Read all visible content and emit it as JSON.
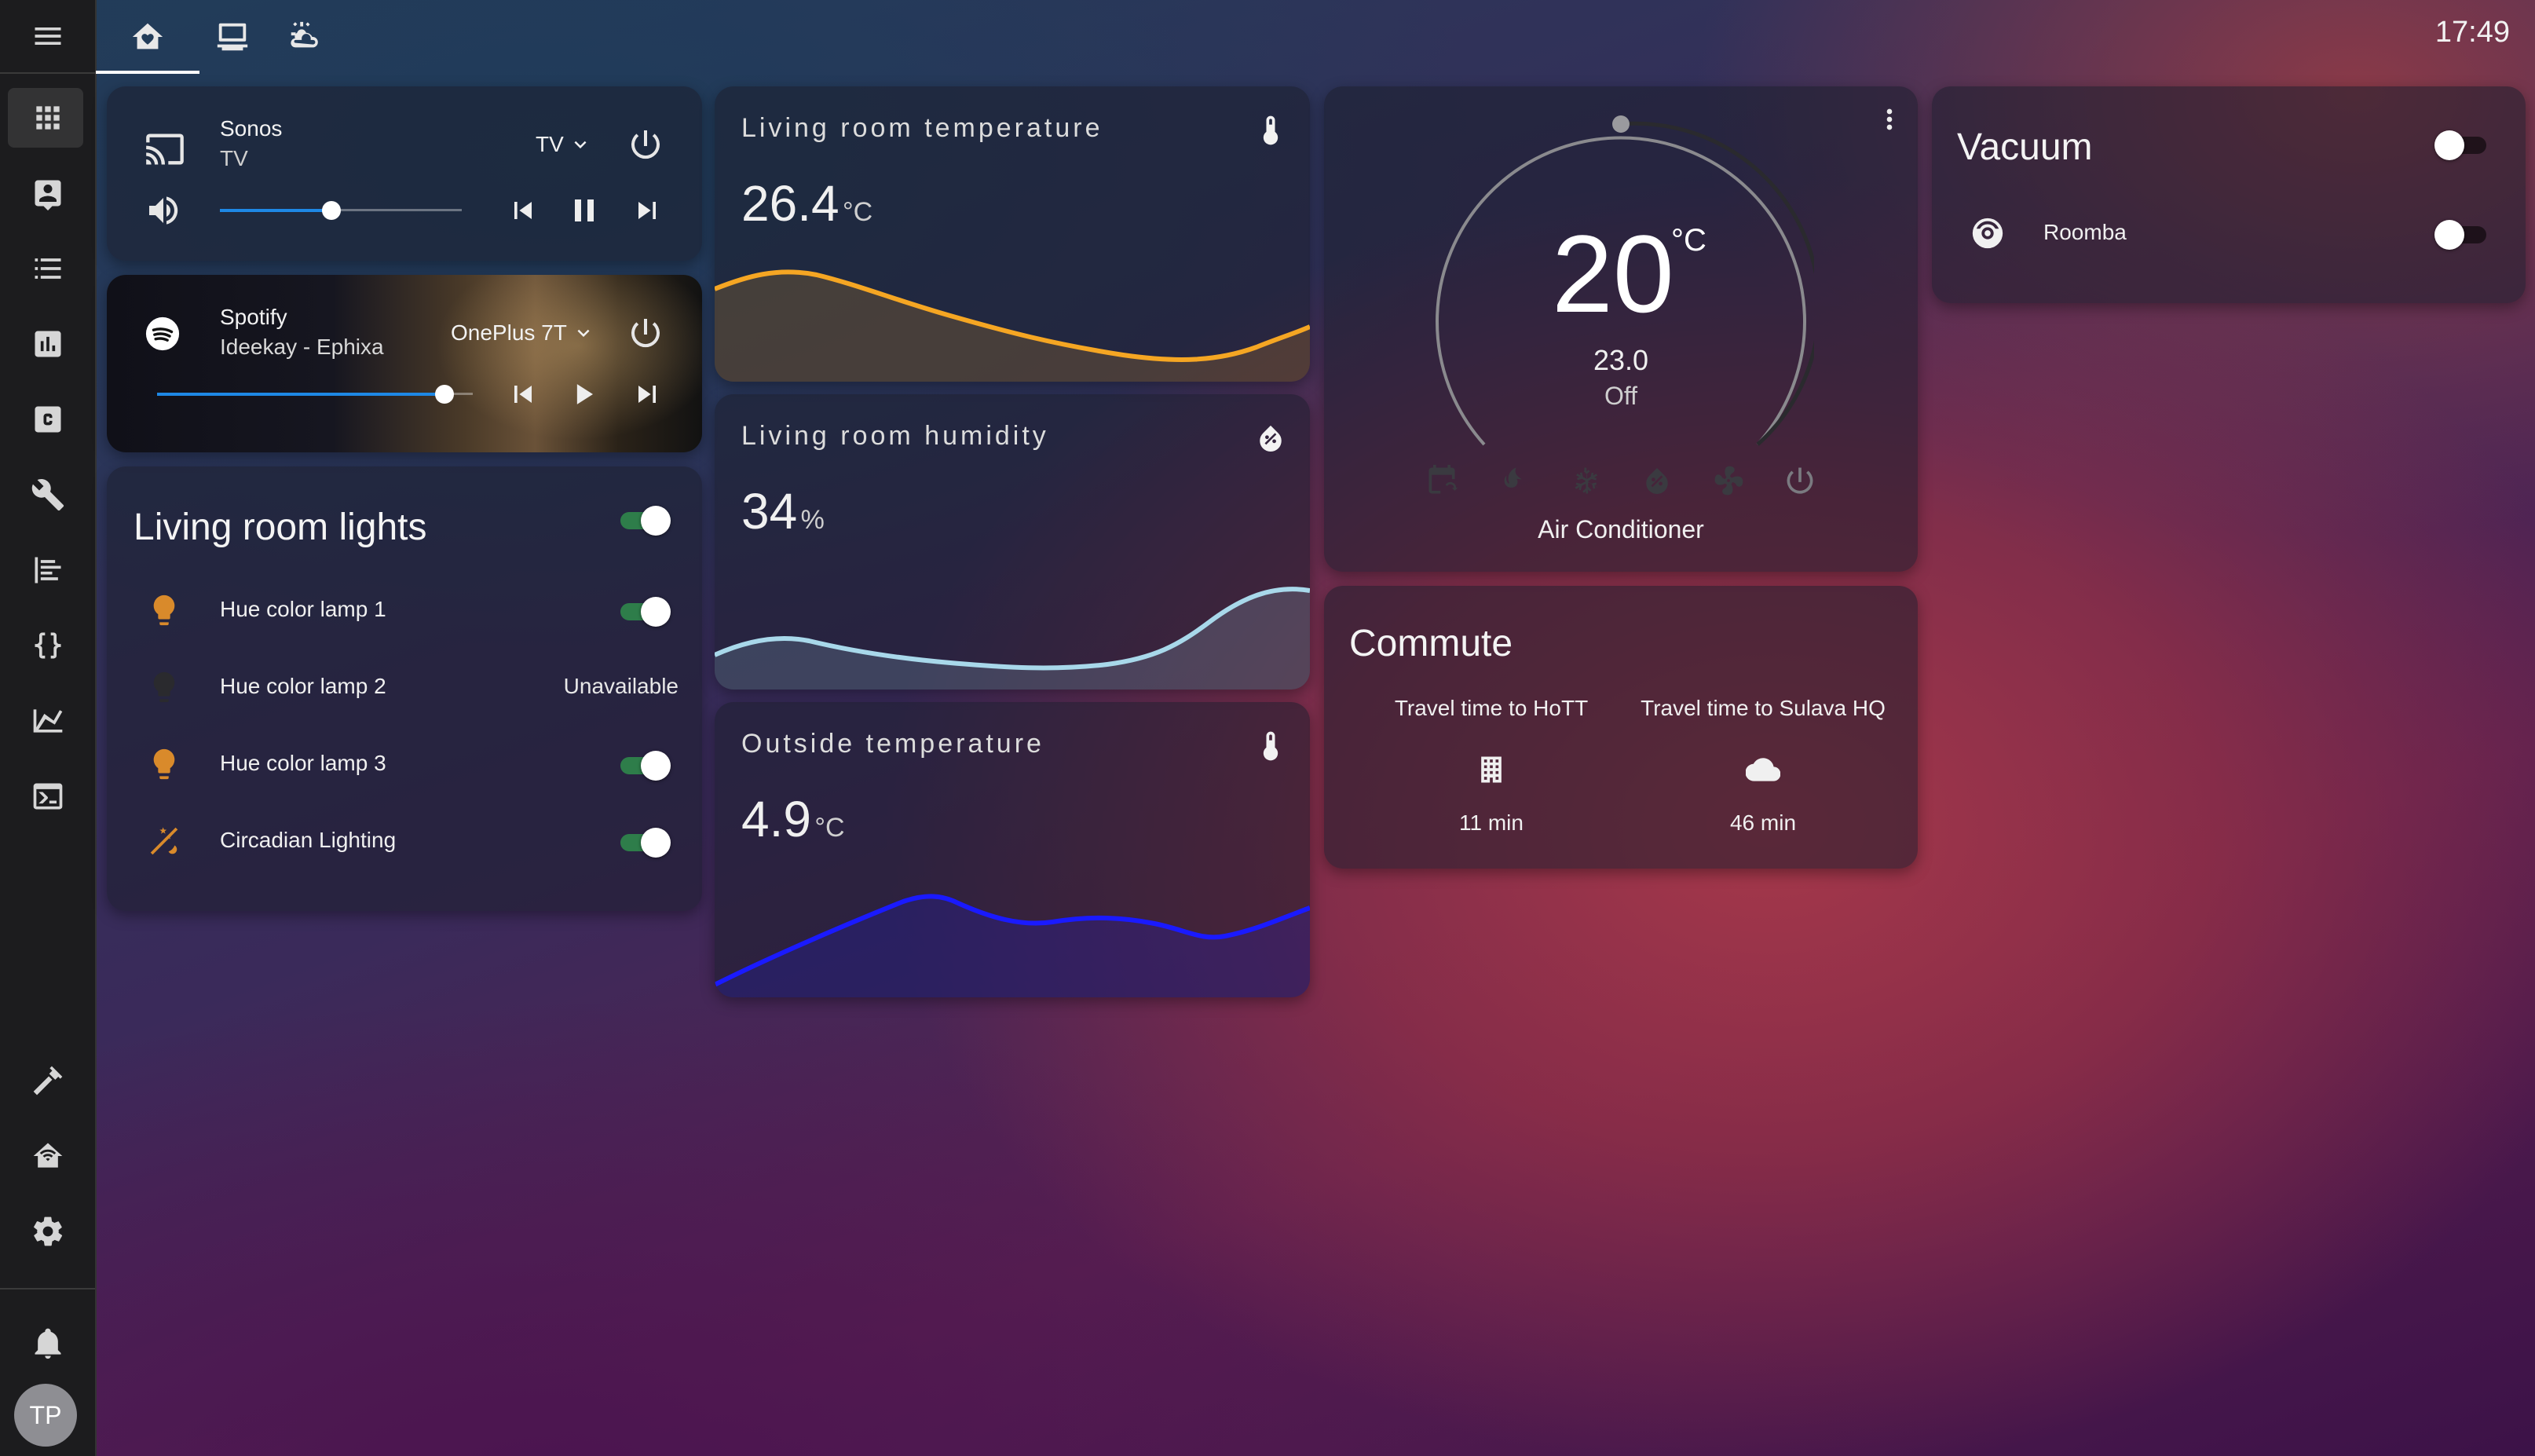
{
  "top_bar": {
    "views": [
      {
        "icon": "home-heart-icon"
      },
      {
        "icon": "laptop-icon"
      },
      {
        "icon": "weather-partly-cloudy-icon"
      }
    ],
    "clock": "17:49"
  },
  "sidebar": {
    "items": [
      "menu-icon",
      "dashboard-grid-icon",
      "contact-card-icon",
      "list-icon",
      "bar-chart-icon",
      "c-box-icon",
      "wrench-icon",
      "timeline-icon",
      "code-braces-icon",
      "line-chart-icon",
      "console-icon",
      "hammer-icon",
      "home-wifi-icon",
      "gear-icon",
      "bell-icon"
    ],
    "avatar_initials": "TP"
  },
  "sonos": {
    "name": "Sonos",
    "source": "TV",
    "source_select": "TV",
    "volume": 0.46
  },
  "spotify": {
    "name": "Spotify",
    "track": "Ideekay - Ephixa",
    "device": "OnePlus 7T",
    "progress": 0.91
  },
  "lights": {
    "title": "Living room lights",
    "master_on": true,
    "items": [
      {
        "name": "Hue color lamp 1",
        "state": "on"
      },
      {
        "name": "Hue color lamp 2",
        "state": "Unavailable"
      },
      {
        "name": "Hue color lamp 3",
        "state": "on"
      },
      {
        "name": "Circadian Lighting",
        "state": "on"
      }
    ]
  },
  "sensors": [
    {
      "name": "Living room temperature",
      "value": "26.4",
      "unit": "°C",
      "color": "#f5a623"
    },
    {
      "name": "Living room humidity",
      "value": "34",
      "unit": "%",
      "color": "#a8d8ea"
    },
    {
      "name": "Outside temperature",
      "value": "4.9",
      "unit": "°C",
      "color": "#1a1aff"
    }
  ],
  "thermostat": {
    "target": "20",
    "unit": "°C",
    "current": "23.0",
    "state": "Off",
    "name": "Air Conditioner",
    "modes": [
      "calendar-sync-icon",
      "fire-icon",
      "snowflake-icon",
      "water-percent-icon",
      "fan-icon",
      "power-icon"
    ]
  },
  "vacuum": {
    "title": "Vacuum",
    "master_on": false,
    "entity": "Roomba",
    "entity_on": false
  },
  "commute": {
    "title": "Commute",
    "items": [
      {
        "label": "Travel time to HoTT",
        "icon": "office-building-icon",
        "value": "11 min"
      },
      {
        "label": "Travel time to Sulava HQ",
        "icon": "cloud-icon",
        "value": "46 min"
      }
    ]
  }
}
